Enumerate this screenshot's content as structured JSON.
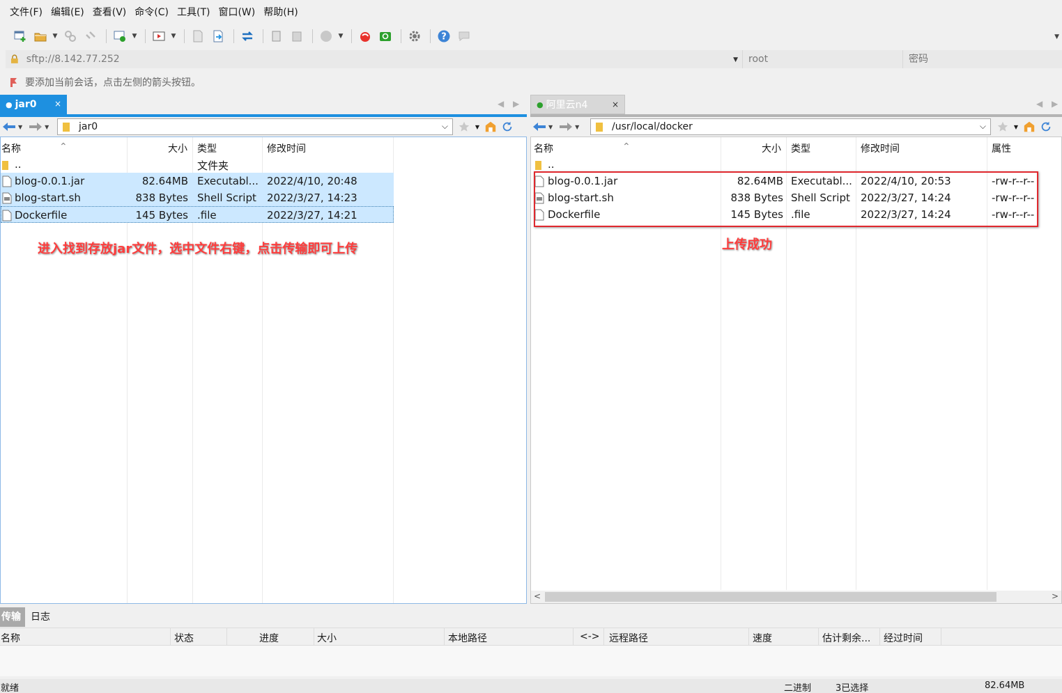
{
  "menu": [
    "文件(F)",
    "编辑(E)",
    "查看(V)",
    "命令(C)",
    "工具(T)",
    "窗口(W)",
    "帮助(H)"
  ],
  "address": {
    "url": "sftp://8.142.77.252",
    "user": "root",
    "password_placeholder": "密码"
  },
  "hint": "要添加当前会话，点击左侧的箭头按钮。",
  "left": {
    "tab": "jar0",
    "path": "jar0",
    "columns": [
      "名称",
      "大小",
      "类型",
      "修改时间"
    ],
    "parent_row": {
      "name": "..",
      "type": "文件夹"
    },
    "files": [
      {
        "name": "blog-0.0.1.jar",
        "size": "82.64MB",
        "type": "Executabl...",
        "modified": "2022/4/10, 20:48"
      },
      {
        "name": "blog-start.sh",
        "size": "838 Bytes",
        "type": "Shell Script",
        "modified": "2022/3/27, 14:23"
      },
      {
        "name": "Dockerfile",
        "size": "145 Bytes",
        "type": ".file",
        "modified": "2022/3/27, 14:21"
      }
    ],
    "annotation": "进入找到存放jar文件，选中文件右键，点击传输即可上传"
  },
  "right": {
    "tab": "阿里云n4",
    "path": "/usr/local/docker",
    "columns": [
      "名称",
      "大小",
      "类型",
      "修改时间",
      "属性"
    ],
    "parent_row": {
      "name": ".."
    },
    "files": [
      {
        "name": "blog-0.0.1.jar",
        "size": "82.64MB",
        "type": "Executabl...",
        "modified": "2022/4/10, 20:53",
        "attr": "-rw-r--r--"
      },
      {
        "name": "blog-start.sh",
        "size": "838 Bytes",
        "type": "Shell Script",
        "modified": "2022/3/27, 14:24",
        "attr": "-rw-r--r--"
      },
      {
        "name": "Dockerfile",
        "size": "145 Bytes",
        "type": ".file",
        "modified": "2022/3/27, 14:24",
        "attr": "-rw-r--r--"
      }
    ],
    "annotation": "上传成功"
  },
  "transfer": {
    "tabs": [
      "传输",
      "日志"
    ],
    "columns": [
      "名称",
      "状态",
      "进度",
      "大小",
      "本地路径",
      "<->",
      "远程路径",
      "速度",
      "估计剩余...",
      "经过时间"
    ]
  },
  "status": {
    "ready": "就绪",
    "mode": "二进制",
    "selection": "3已选择",
    "size": "82.64MB"
  },
  "colors": {
    "accent": "#1e90e0",
    "selection": "#cce8ff",
    "annotation": "#ff3c3c"
  }
}
